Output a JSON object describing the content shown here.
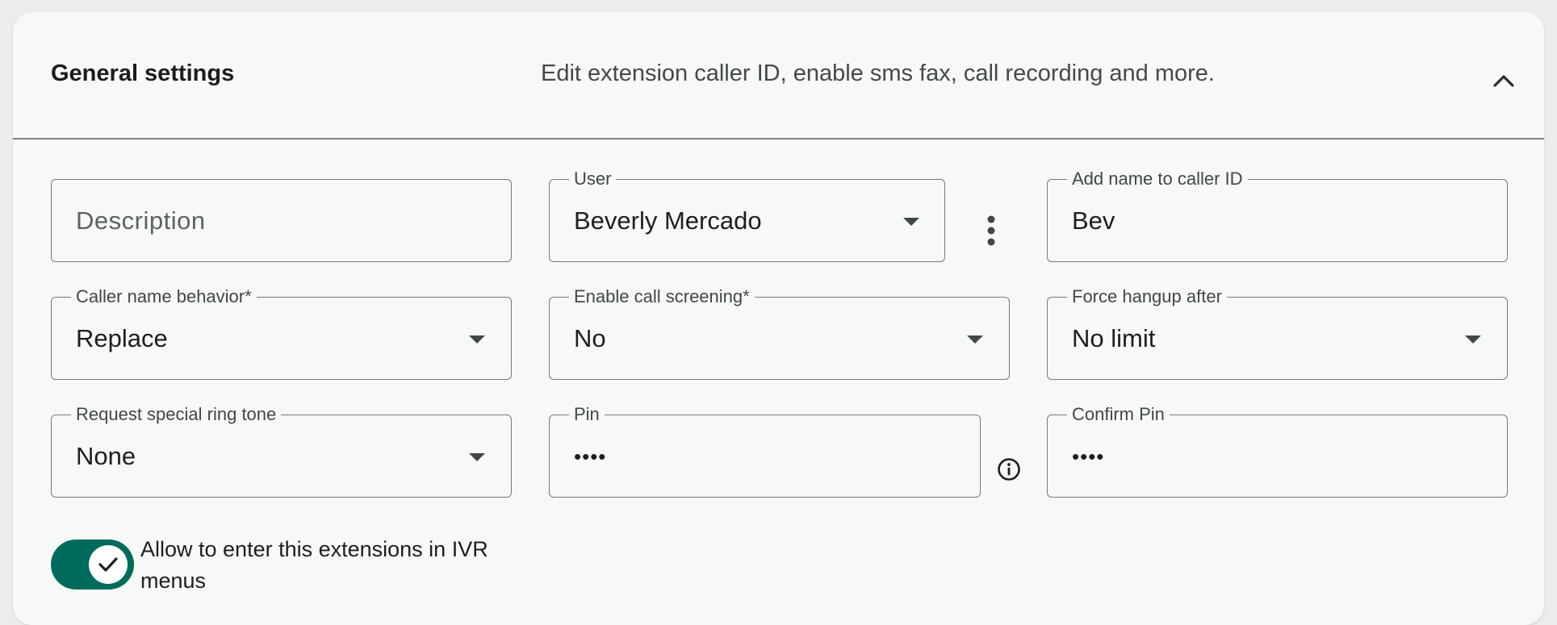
{
  "panel": {
    "title": "General settings",
    "subtitle": "Edit extension caller ID, enable sms fax, call recording and more.",
    "collapse_icon": "chevron-up-icon"
  },
  "fields": {
    "description": {
      "placeholder": "Description",
      "value": ""
    },
    "user": {
      "label": "User",
      "value": "Beverly Mercado",
      "more_icon": "more-vert-icon"
    },
    "caller_id_name": {
      "label": "Add name to caller ID",
      "value": "Bev"
    },
    "caller_name_behavior": {
      "label": "Caller name behavior*",
      "value": "Replace"
    },
    "call_screening": {
      "label": "Enable call screening*",
      "value": "No"
    },
    "force_hangup": {
      "label": "Force hangup after",
      "value": "No limit"
    },
    "ring_tone": {
      "label": "Request special ring tone",
      "value": "None"
    },
    "pin": {
      "label": "Pin",
      "value": "••••",
      "info_icon": "info-icon"
    },
    "confirm_pin": {
      "label": "Confirm Pin",
      "value": "••••"
    }
  },
  "ivr_toggle": {
    "label": "Allow to enter this extensions in IVR menus",
    "checked": true,
    "icon": "check-icon"
  },
  "colors": {
    "accent": "#006b5c",
    "card_bg": "#f6f9f7",
    "page_bg": "#ecedea",
    "outline": "#767c79"
  }
}
